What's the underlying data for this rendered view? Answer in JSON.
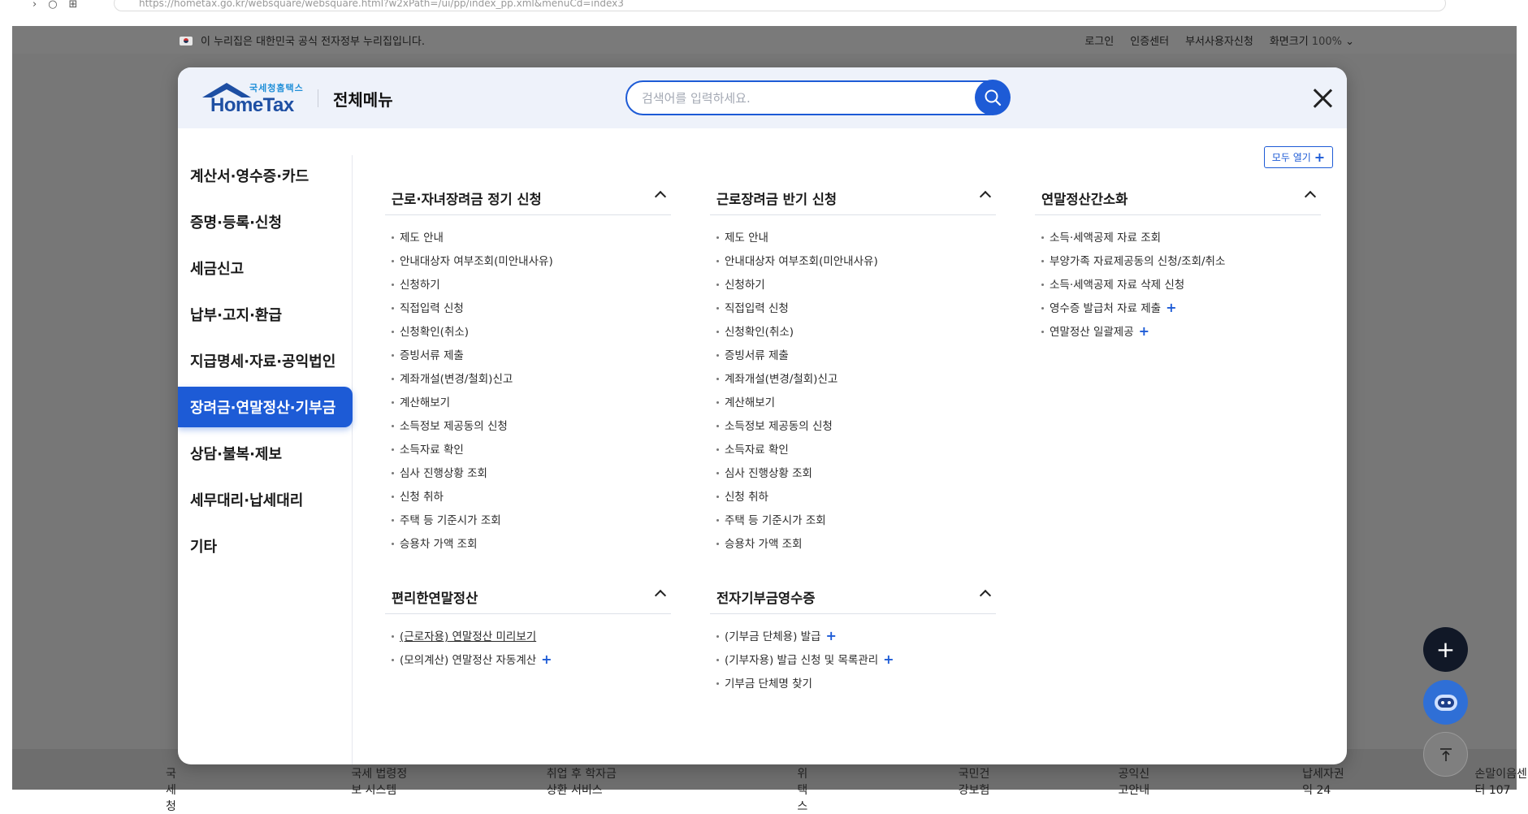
{
  "browser": {
    "url": "https://hometax.go.kr/websquare/websquare.html?w2xPath=/ui/pp/index_pp.xml&menuCd=index3"
  },
  "gov_bar": {
    "notice": "이 누리집은 대한민국 공식 전자정부 누리집입니다.",
    "links": [
      "로그인",
      "인증센터",
      "부서사용자신청"
    ],
    "zoom_label": "화면크기",
    "zoom_value": "100%"
  },
  "footer_links": [
    "국세청",
    "국세 법령정보 시스템",
    "취업 후 학자금상환 서비스",
    "위택스",
    "국민건강보험",
    "공익신고안내",
    "납세자권익 24",
    "손말이음센터 107"
  ],
  "modal": {
    "logo_sub": "국세청홈택스",
    "logo_main": "HomeTax",
    "title": "전체메뉴",
    "search_placeholder": "검색어를 입력하세요.",
    "open_all_label": "모두 열기",
    "open_all_icon": "+"
  },
  "sidebar": {
    "items": [
      {
        "label": "계산서·영수증·카드",
        "active": false
      },
      {
        "label": "증명·등록·신청",
        "active": false
      },
      {
        "label": "세금신고",
        "active": false
      },
      {
        "label": "납부·고지·환급",
        "active": false
      },
      {
        "label": "지급명세·자료·공익법인",
        "active": false
      },
      {
        "label": "장려금·연말정산·기부금",
        "active": true
      },
      {
        "label": "상담·불복·제보",
        "active": false
      },
      {
        "label": "세무대리·납세대리",
        "active": false
      },
      {
        "label": "기타",
        "active": false
      }
    ]
  },
  "sections": {
    "s1": {
      "title": "근로·자녀장려금 정기 신청",
      "items": [
        "제도 안내",
        "안내대상자 여부조회(미안내사유)",
        "신청하기",
        "직접입력 신청",
        "신청확인(취소)",
        "증빙서류 제출",
        "계좌개설(변경/철회)신고",
        "계산해보기",
        "소득정보 제공동의 신청",
        "소득자료 확인",
        "심사 진행상황 조회",
        "신청 취하",
        "주택 등 기준시가 조회",
        "승용차 가액 조회"
      ]
    },
    "s2": {
      "title": "근로장려금 반기 신청",
      "items": [
        "제도 안내",
        "안내대상자 여부조회(미안내사유)",
        "신청하기",
        "직접입력 신청",
        "신청확인(취소)",
        "증빙서류 제출",
        "계좌개설(변경/철회)신고",
        "계산해보기",
        "소득정보 제공동의 신청",
        "소득자료 확인",
        "심사 진행상황 조회",
        "신청 취하",
        "주택 등 기준시가 조회",
        "승용차 가액 조회"
      ]
    },
    "s3": {
      "title": "연말정산간소화",
      "items": [
        "소득·세액공제 자료 조회",
        "부양가족 자료제공동의 신청/조회/취소",
        "소득·세액공제 자료 삭제 신청",
        "영수증 발급처 자료 제출",
        "연말정산 일괄제공"
      ],
      "more_flags": [
        false,
        false,
        false,
        true,
        true
      ]
    },
    "s4": {
      "title": "편리한연말정산",
      "items": [
        "(근로자용) 연말정산 미리보기",
        "(모의계산) 연말정산 자동계산"
      ],
      "more_flags": [
        false,
        true
      ]
    },
    "s5": {
      "title": "전자기부금영수증",
      "items": [
        "(기부금 단체용) 발급",
        "(기부자용) 발급 신청 및 목록관리",
        "기부금 단체명 찾기"
      ],
      "more_flags": [
        true,
        true,
        false
      ]
    }
  },
  "more_icon": "+",
  "fab": {
    "plus_label": "+"
  }
}
